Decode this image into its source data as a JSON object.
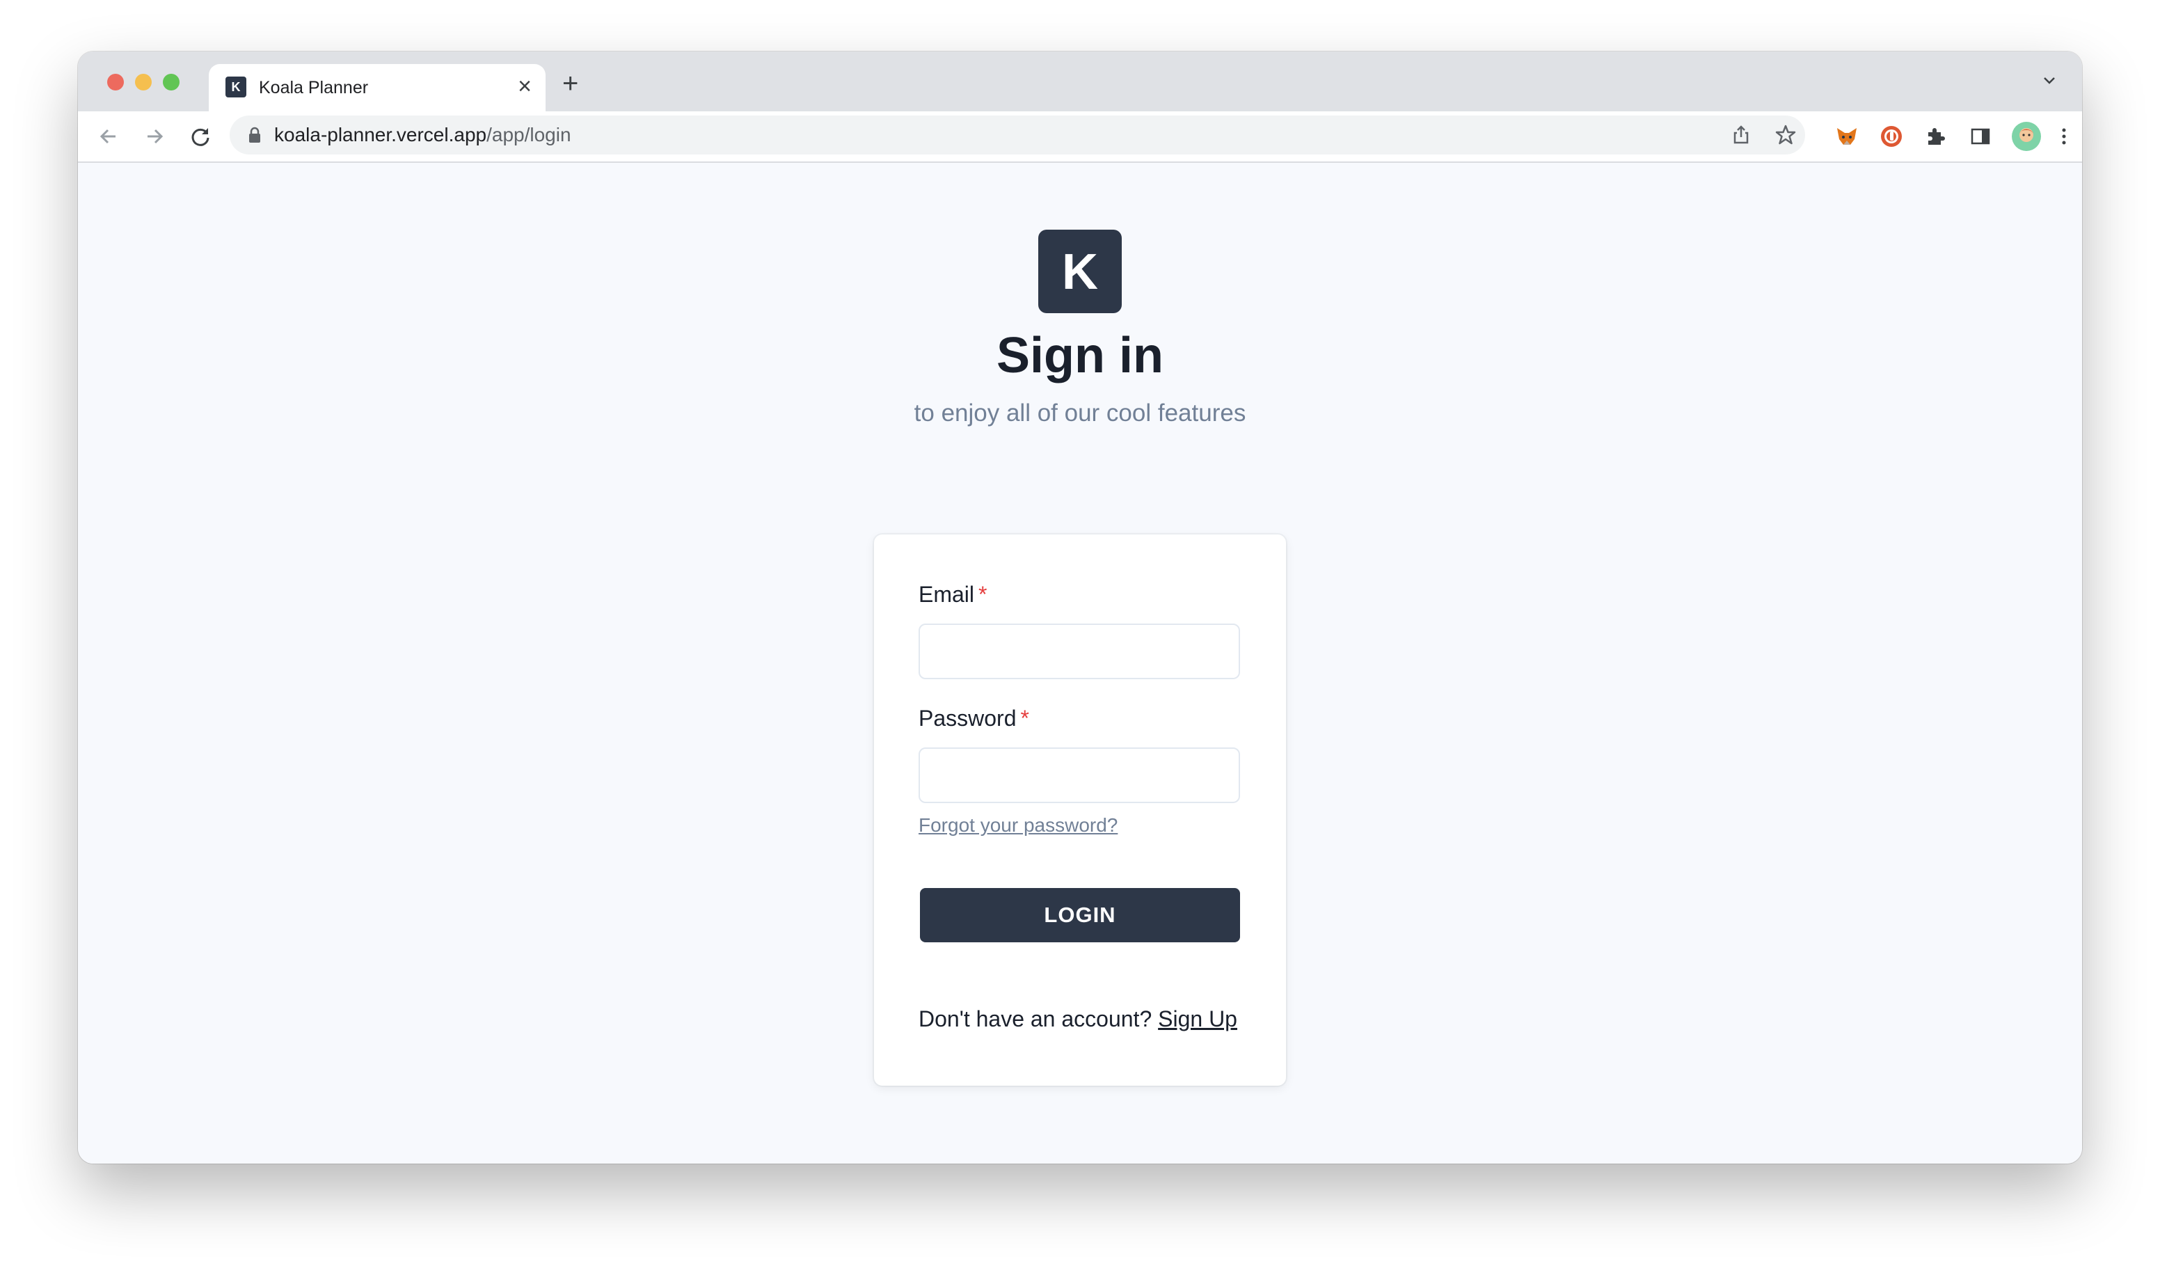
{
  "browser": {
    "tab": {
      "favicon_letter": "K",
      "title": "Koala Planner",
      "close": "×"
    },
    "new_tab": "+",
    "url": {
      "host": "koala-planner.vercel.app",
      "path": "/app/login"
    }
  },
  "page": {
    "logo_letter": "K",
    "title": "Sign in",
    "subtitle": "to enjoy all of our cool features"
  },
  "form": {
    "email_label": "Email",
    "password_label": "Password",
    "required_mark": "*",
    "email_value": "",
    "password_value": "",
    "forgot_password": "Forgot your password?",
    "login_button": "LOGIN",
    "no_account": "Don't have an account?",
    "sign_up": "Sign Up"
  },
  "icons": [
    "back-icon",
    "forward-icon",
    "reload-icon",
    "lock-icon",
    "share-icon",
    "bookmark-star-icon",
    "metamask-icon",
    "duckduckgo-icon",
    "extensions-icon",
    "side-panel-icon",
    "profile-avatar",
    "more-menu-icon"
  ],
  "colors": {
    "primary": "#2d3748",
    "required": "#e53e3e",
    "page_bg": "#f7f9fd"
  }
}
